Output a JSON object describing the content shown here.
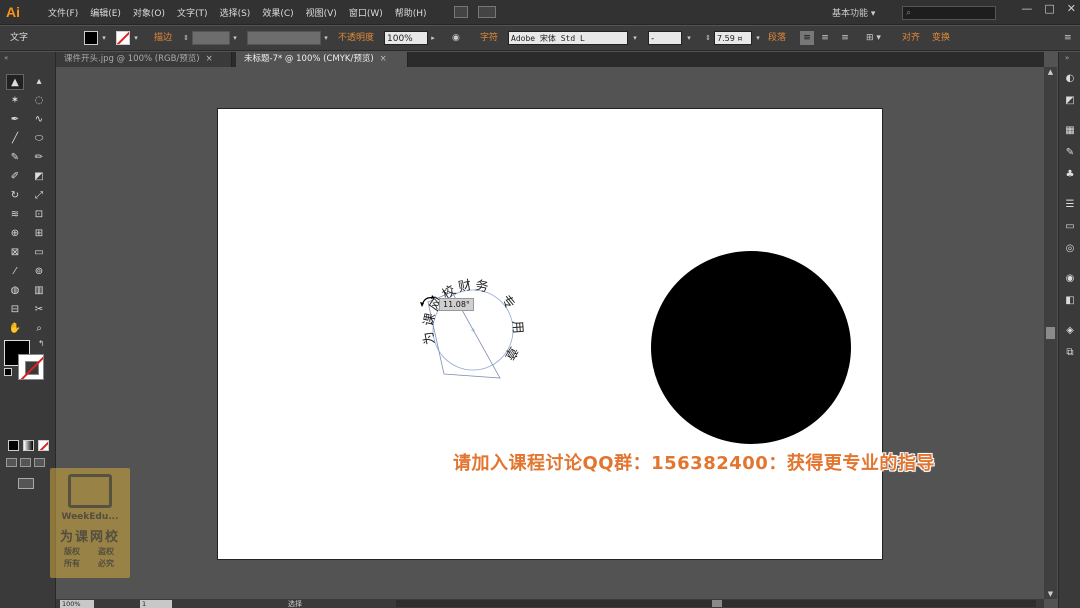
{
  "app": {
    "logo": "Ai"
  },
  "menu": [
    "文件(F)",
    "编辑(E)",
    "对象(O)",
    "文字(T)",
    "选择(S)",
    "效果(C)",
    "视图(V)",
    "窗口(W)",
    "帮助(H)"
  ],
  "workspace": "基本功能",
  "window_controls": [
    "—",
    "□",
    "✕"
  ],
  "control_bar": {
    "tool_label": "文字",
    "stroke_link": "描边",
    "opacity_link": "不透明度",
    "opacity_value": "100%",
    "char_link": "字符",
    "font_family": "Adobe 宋体 Std L",
    "font_style": "-",
    "font_size": "7.59 ",
    "font_size_unit": "¤",
    "para_link": "段落",
    "align_link": "对齐",
    "transform_link": "变换"
  },
  "tabs": [
    {
      "label": "课件开头.jpg @ 100% (RGB/预览)",
      "close": "×",
      "active": false
    },
    {
      "label": "未标题-7* @ 100% (CMYK/预览)",
      "close": "×",
      "active": true
    }
  ],
  "canvas": {
    "rotation_tooltip": "11.08°",
    "path_text": [
      "为",
      "课",
      "网",
      "校",
      "财",
      "务",
      "专",
      "用",
      "章"
    ],
    "caption": "请加入课程讨论QQ群：156382400：获得更专业的指导"
  },
  "watermark": {
    "brand": "WeekEdu...",
    "title": "为课网校",
    "left_line1": "版权",
    "left_line2": "所有",
    "right_line1": "盗权",
    "right_line2": "必究"
  },
  "status": {
    "zoom": "100%",
    "page": "1",
    "mode": "选择"
  },
  "colors": {
    "caption": "#e2752f",
    "logo": "#f7931e",
    "link": "#e0893a"
  }
}
